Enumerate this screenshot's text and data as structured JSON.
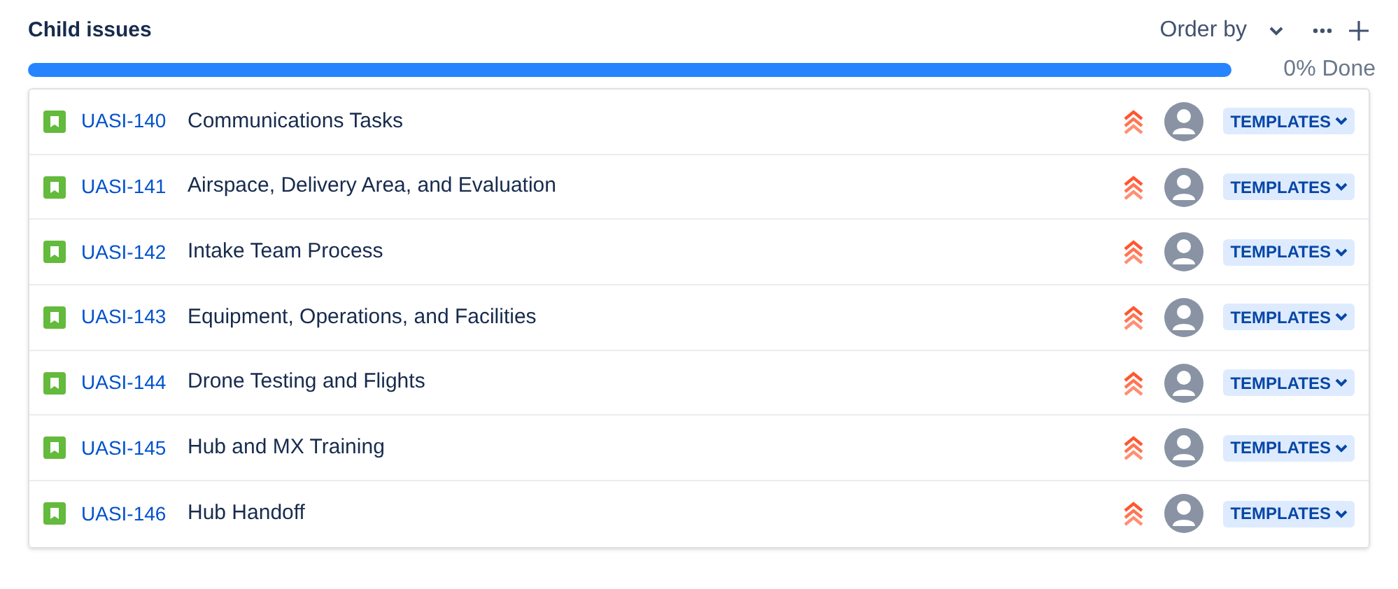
{
  "title": "Child issues",
  "toolbar": {
    "order_by": "Order by"
  },
  "progress": {
    "level": 0,
    "label": "0% Done"
  },
  "issues": [
    {
      "key": "UASI-140",
      "summary": "Communications Tasks",
      "status": "TEMPLATES"
    },
    {
      "key": "UASI-141",
      "summary": "Airspace, Delivery Area, and Evaluation",
      "status": "TEMPLATES"
    },
    {
      "key": "UASI-142",
      "summary": "Intake Team Process",
      "status": "TEMPLATES"
    },
    {
      "key": "UASI-143",
      "summary": "Equipment, Operations, and Facilities",
      "status": "TEMPLATES"
    },
    {
      "key": "UASI-144",
      "summary": "Drone Testing and Flights",
      "status": "TEMPLATES"
    },
    {
      "key": "UASI-145",
      "summary": "Hub and MX Training",
      "status": "TEMPLATES"
    },
    {
      "key": "UASI-146",
      "summary": "Hub Handoff",
      "status": "TEMPLATES"
    }
  ]
}
